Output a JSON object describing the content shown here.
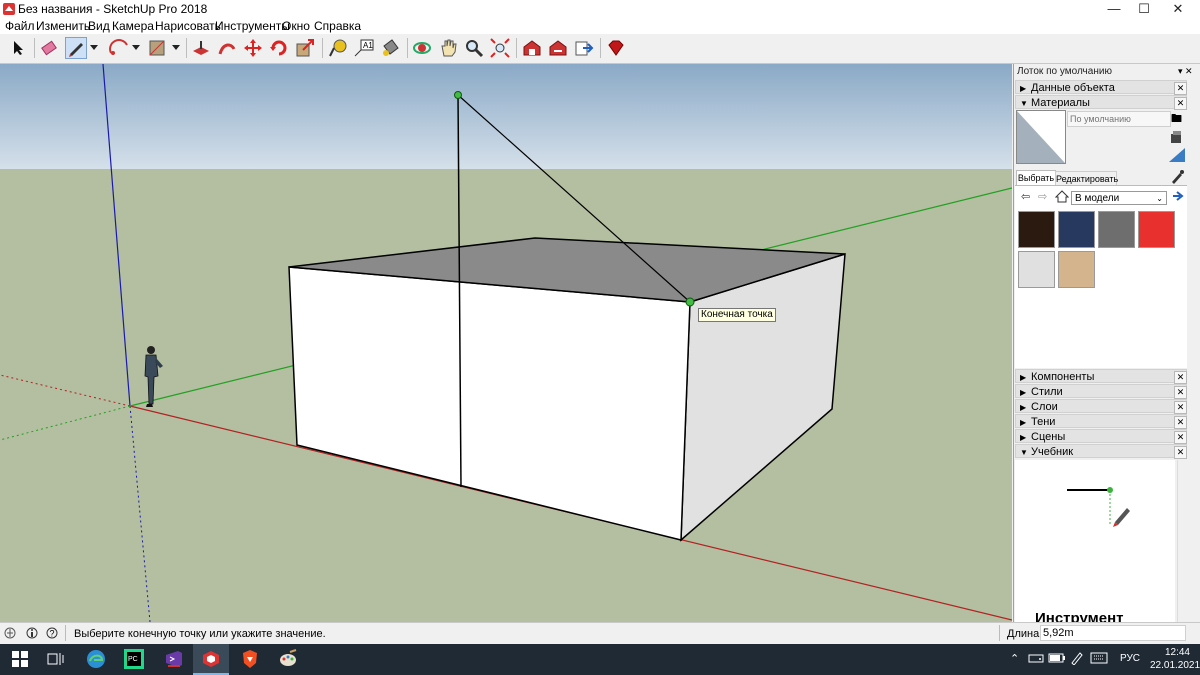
{
  "window": {
    "title": "Без названия - SketchUp Pro 2018",
    "minimize": "—",
    "maximize": "☐",
    "close": "✕"
  },
  "menu": [
    "Файл",
    "Изменить",
    "Вид",
    "Камера",
    "Нарисовать",
    "Инструменты",
    "Окно",
    "Справка"
  ],
  "toolbar": {
    "tools": [
      "select-icon",
      "eraser-icon",
      "pencil-icon",
      "dropdown-icon",
      "arc-icon",
      "dropdown-icon",
      "rectangle-icon",
      "dropdown-icon",
      "push-pull-icon",
      "follow-me-icon",
      "move-icon",
      "rotate-icon",
      "scale-icon",
      "tape-measure-icon",
      "text-icon",
      "paint-bucket-icon",
      "orbit-icon",
      "pan-icon",
      "zoom-icon",
      "zoom-extents-icon",
      "warehouse-icon",
      "extension-warehouse-icon",
      "send-to-layout-icon",
      "ruby-icon"
    ]
  },
  "viewport": {
    "tooltip": "Конечная точка"
  },
  "tray": {
    "title": "Лоток по умолчанию",
    "panels_top": [
      {
        "label": "Данные объекта",
        "expanded": false
      },
      {
        "label": "Материалы",
        "expanded": true
      }
    ],
    "materials": {
      "name_placeholder": "По умолчанию",
      "tab_select": "Выбрать",
      "tab_edit": "Редактировать",
      "collection": "В модели",
      "swatches": [
        "#2a1a10",
        "#27395e",
        "#6e6e6e",
        "#e8302e",
        "#e0e0e0",
        "#d4b48c"
      ]
    },
    "panels_bottom": [
      {
        "label": "Компоненты",
        "expanded": false
      },
      {
        "label": "Стили",
        "expanded": false
      },
      {
        "label": "Слои",
        "expanded": false
      },
      {
        "label": "Тени",
        "expanded": false
      },
      {
        "label": "Сцены",
        "expanded": false
      },
      {
        "label": "Учебник",
        "expanded": true
      }
    ],
    "instructor_heading": "Инструмент"
  },
  "status": {
    "message": "Выберите конечную точку или укажите значение.",
    "measure_label": "Длина",
    "measure_value": "5,92m"
  },
  "taskbar": {
    "apps": [
      "start-icon",
      "task-view-icon",
      "edge-icon",
      "pycharm-icon",
      "visual-studio-icon",
      "sketchup-icon",
      "brave-icon",
      "paint-icon"
    ],
    "language": "РУС",
    "time": "12:44",
    "date": "22.01.2021"
  },
  "colors": {
    "sky": "#a6bdd4",
    "ground": "#b3bfa0",
    "red_axis": "#b22222",
    "green_axis": "#22a022",
    "blue_axis": "#1a1aa8",
    "roof": "#8a8a8a",
    "accent": "#1f2a35"
  }
}
